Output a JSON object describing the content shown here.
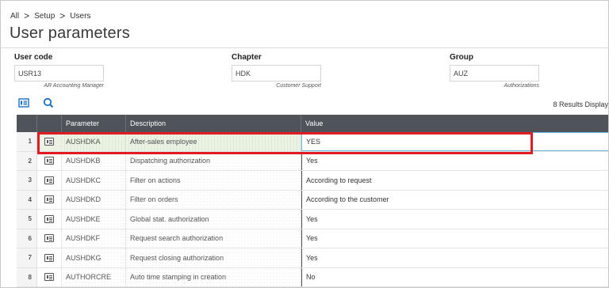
{
  "breadcrumb": {
    "items": [
      "All",
      "Setup",
      "Users"
    ],
    "separator": ">"
  },
  "page": {
    "title": "User parameters"
  },
  "fields": {
    "user_code": {
      "label": "User code",
      "value": "USR13",
      "sub": "AR Accounting Manager"
    },
    "chapter": {
      "label": "Chapter",
      "value": "HDK",
      "sub": "Customer Support"
    },
    "group": {
      "label": "Group",
      "value": "AUZ",
      "sub": "Authorizations"
    }
  },
  "toolbar": {
    "icons": [
      "list-view-icon",
      "search-icon"
    ],
    "results_text": "8 Results  Display"
  },
  "grid": {
    "columns": [
      "Parameter",
      "Description",
      "Value"
    ],
    "rows": [
      {
        "num": "1",
        "parameter": "AUSHDKA",
        "description": "After-sales employee",
        "value": "YES"
      },
      {
        "num": "2",
        "parameter": "AUSHDKB",
        "description": "Dispatching authorization",
        "value": "Yes"
      },
      {
        "num": "3",
        "parameter": "AUSHDKC",
        "description": "Filter on actions",
        "value": "According to request"
      },
      {
        "num": "4",
        "parameter": "AUSHDKD",
        "description": "Filter on orders",
        "value": "According to the customer"
      },
      {
        "num": "5",
        "parameter": "AUSHDKE",
        "description": "Global stat. authorization",
        "value": "Yes"
      },
      {
        "num": "6",
        "parameter": "AUSHDKF",
        "description": "Request search authorization",
        "value": "Yes"
      },
      {
        "num": "7",
        "parameter": "AUSHDKG",
        "description": "Request closing authorization",
        "value": "Yes"
      },
      {
        "num": "8",
        "parameter": "AUTHORCRE",
        "description": "Auto time stamping in creation",
        "value": "No"
      }
    ]
  },
  "colors": {
    "header_bg": "#4e5459",
    "selected_row": "#eaf3e4",
    "highlight": "#e01b22",
    "accent": "#1a6fc4"
  }
}
